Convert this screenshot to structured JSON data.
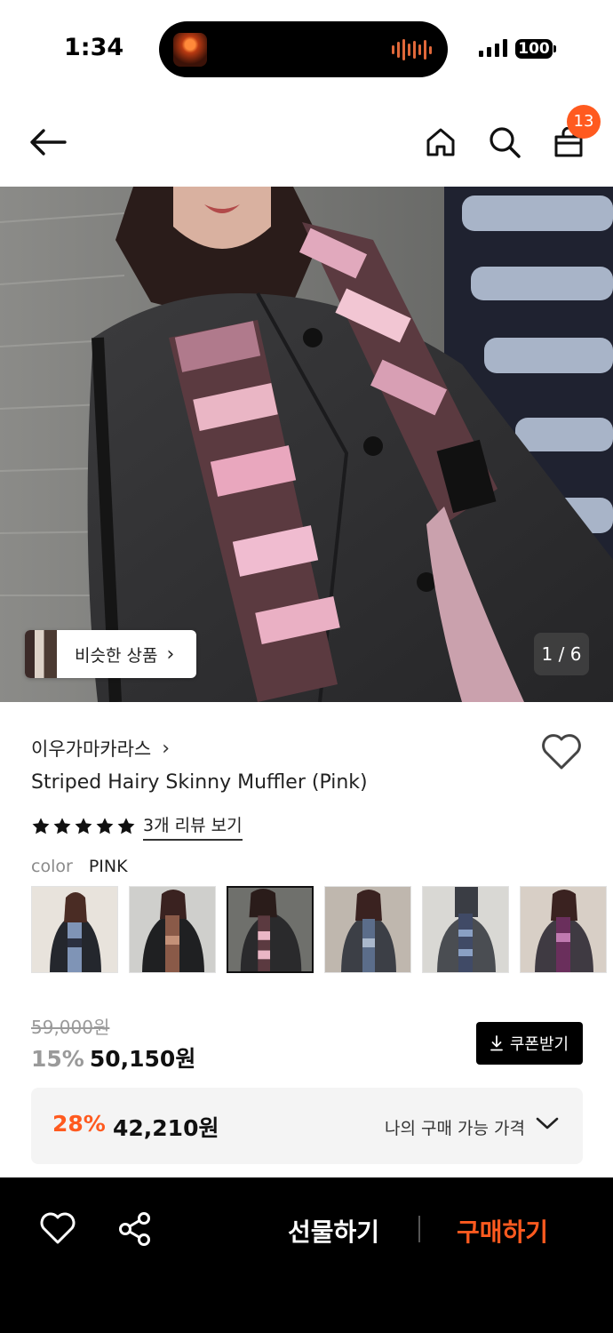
{
  "status_bar": {
    "time": "1:34",
    "battery": "100"
  },
  "header": {
    "cart_count": "13"
  },
  "gallery": {
    "page_indicator": "1 / 6",
    "similar_label": "비슷한 상품"
  },
  "product": {
    "brand": "이우가마카라스",
    "name": "Striped Hairy Skinny Muffler (Pink)",
    "rating": 5,
    "review_link": "3개 리뷰 보기",
    "color_label": "color",
    "color_value": "PINK"
  },
  "price": {
    "original": "59,000원",
    "discount": "15%",
    "sale": "50,150원",
    "coupon_label": "쿠폰받기"
  },
  "my_price": {
    "discount": "28%",
    "amount": "42,210원",
    "label": "나의 구매 가능 가격"
  },
  "bottom_bar": {
    "gift_label": "선물하기",
    "buy_label": "구매하기"
  },
  "colors": {
    "accent": "#ff5a1f",
    "dark": "#000000"
  }
}
